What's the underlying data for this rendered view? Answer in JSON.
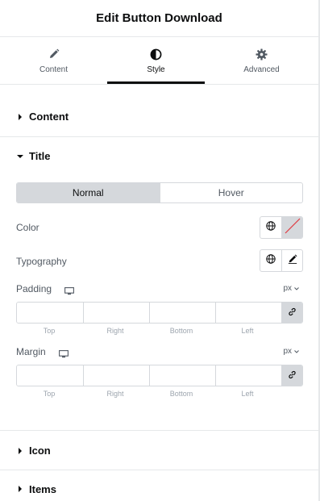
{
  "header": {
    "title": "Edit Button Download"
  },
  "tabs": [
    {
      "label": "Content",
      "icon": "pencil-icon"
    },
    {
      "label": "Style",
      "icon": "contrast-icon",
      "active": true
    },
    {
      "label": "Advanced",
      "icon": "gear-icon"
    }
  ],
  "sections": {
    "content": {
      "label": "Content",
      "expanded": false
    },
    "title": {
      "label": "Title",
      "expanded": true
    },
    "icon": {
      "label": "Icon",
      "expanded": false
    },
    "items": {
      "label": "Items",
      "expanded": false
    }
  },
  "state_toggle": {
    "normal": "Normal",
    "hover": "Hover",
    "selected": "Normal"
  },
  "controls": {
    "color": {
      "label": "Color"
    },
    "typography": {
      "label": "Typography"
    },
    "padding": {
      "label": "Padding",
      "unit": "px",
      "values": {
        "top": "",
        "right": "",
        "bottom": "",
        "left": ""
      },
      "sub_labels": {
        "top": "Top",
        "right": "Right",
        "bottom": "Bottom",
        "left": "Left"
      }
    },
    "margin": {
      "label": "Margin",
      "unit": "px",
      "values": {
        "top": "",
        "right": "",
        "bottom": "",
        "left": ""
      },
      "sub_labels": {
        "top": "Top",
        "right": "Right",
        "bottom": "Bottom",
        "left": "Left"
      }
    }
  },
  "colors": {
    "accent": "#0c0d0e",
    "border": "#d5d8dc",
    "muted": "#515962",
    "no_color_slash": "#e0383e"
  }
}
